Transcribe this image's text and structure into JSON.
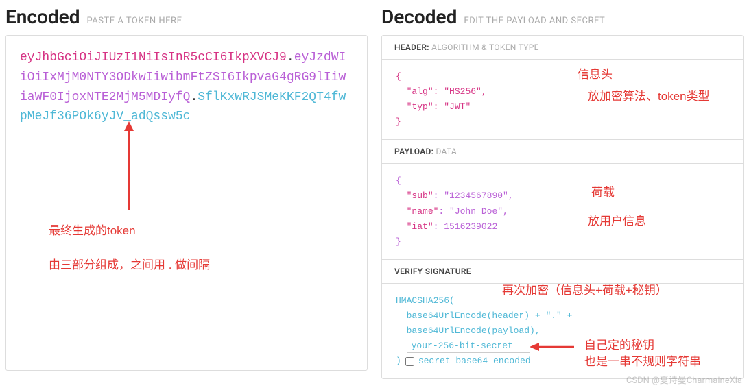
{
  "encoded": {
    "title": "Encoded",
    "subtitle": "PASTE A TOKEN HERE",
    "token_header": "eyJhbGciOiJIUzI1NiIsInR5cCI6IkpXVCJ9",
    "token_payload": "eyJzdWIiOiIxMjM0NTY3ODkwIiwibmFtZSI6IkpvaG4gRG9lIiwiaWF0IjoxNTE2MjM5MDIyfQ",
    "token_signature": "SflKxwRJSMeKKF2QT4fwpMeJf36POk6yJV_adQssw5c"
  },
  "decoded": {
    "title": "Decoded",
    "subtitle": "EDIT THE PAYLOAD AND SECRET",
    "header_section": {
      "label": "HEADER:",
      "sublabel": "ALGORITHM & TOKEN TYPE",
      "alg_key": "\"alg\"",
      "alg_val": "\"HS256\"",
      "typ_key": "\"typ\"",
      "typ_val": "\"JWT\""
    },
    "payload_section": {
      "label": "PAYLOAD:",
      "sublabel": "DATA",
      "sub_key": "\"sub\"",
      "sub_val": "\"1234567890\"",
      "name_key": "\"name\"",
      "name_val": "\"John Doe\"",
      "iat_key": "\"iat\"",
      "iat_val": "1516239022"
    },
    "signature_section": {
      "label": "VERIFY SIGNATURE",
      "line1": "HMACSHA256(",
      "line2": "base64UrlEncode(header) + \".\" +",
      "line3": "base64UrlEncode(payload),",
      "secret_value": "your-256-bit-secret",
      "line5_prefix": ")",
      "checkbox_label": "secret base64 encoded"
    }
  },
  "annotations": {
    "encoded_ann1": "最终生成的token",
    "encoded_ann2": "由三部分组成，之间用 . 做间隔",
    "header_ann1": "信息头",
    "header_ann2": "放加密算法、token类型",
    "payload_ann1": "荷载",
    "payload_ann2": "放用户信息",
    "sig_ann1": "再次加密（信息头+荷载+秘钥）",
    "sig_ann2": "自己定的秘钥",
    "sig_ann3": "也是一串不规则字符串"
  },
  "watermark": "CSDN @夏诗曼CharmaineXia"
}
